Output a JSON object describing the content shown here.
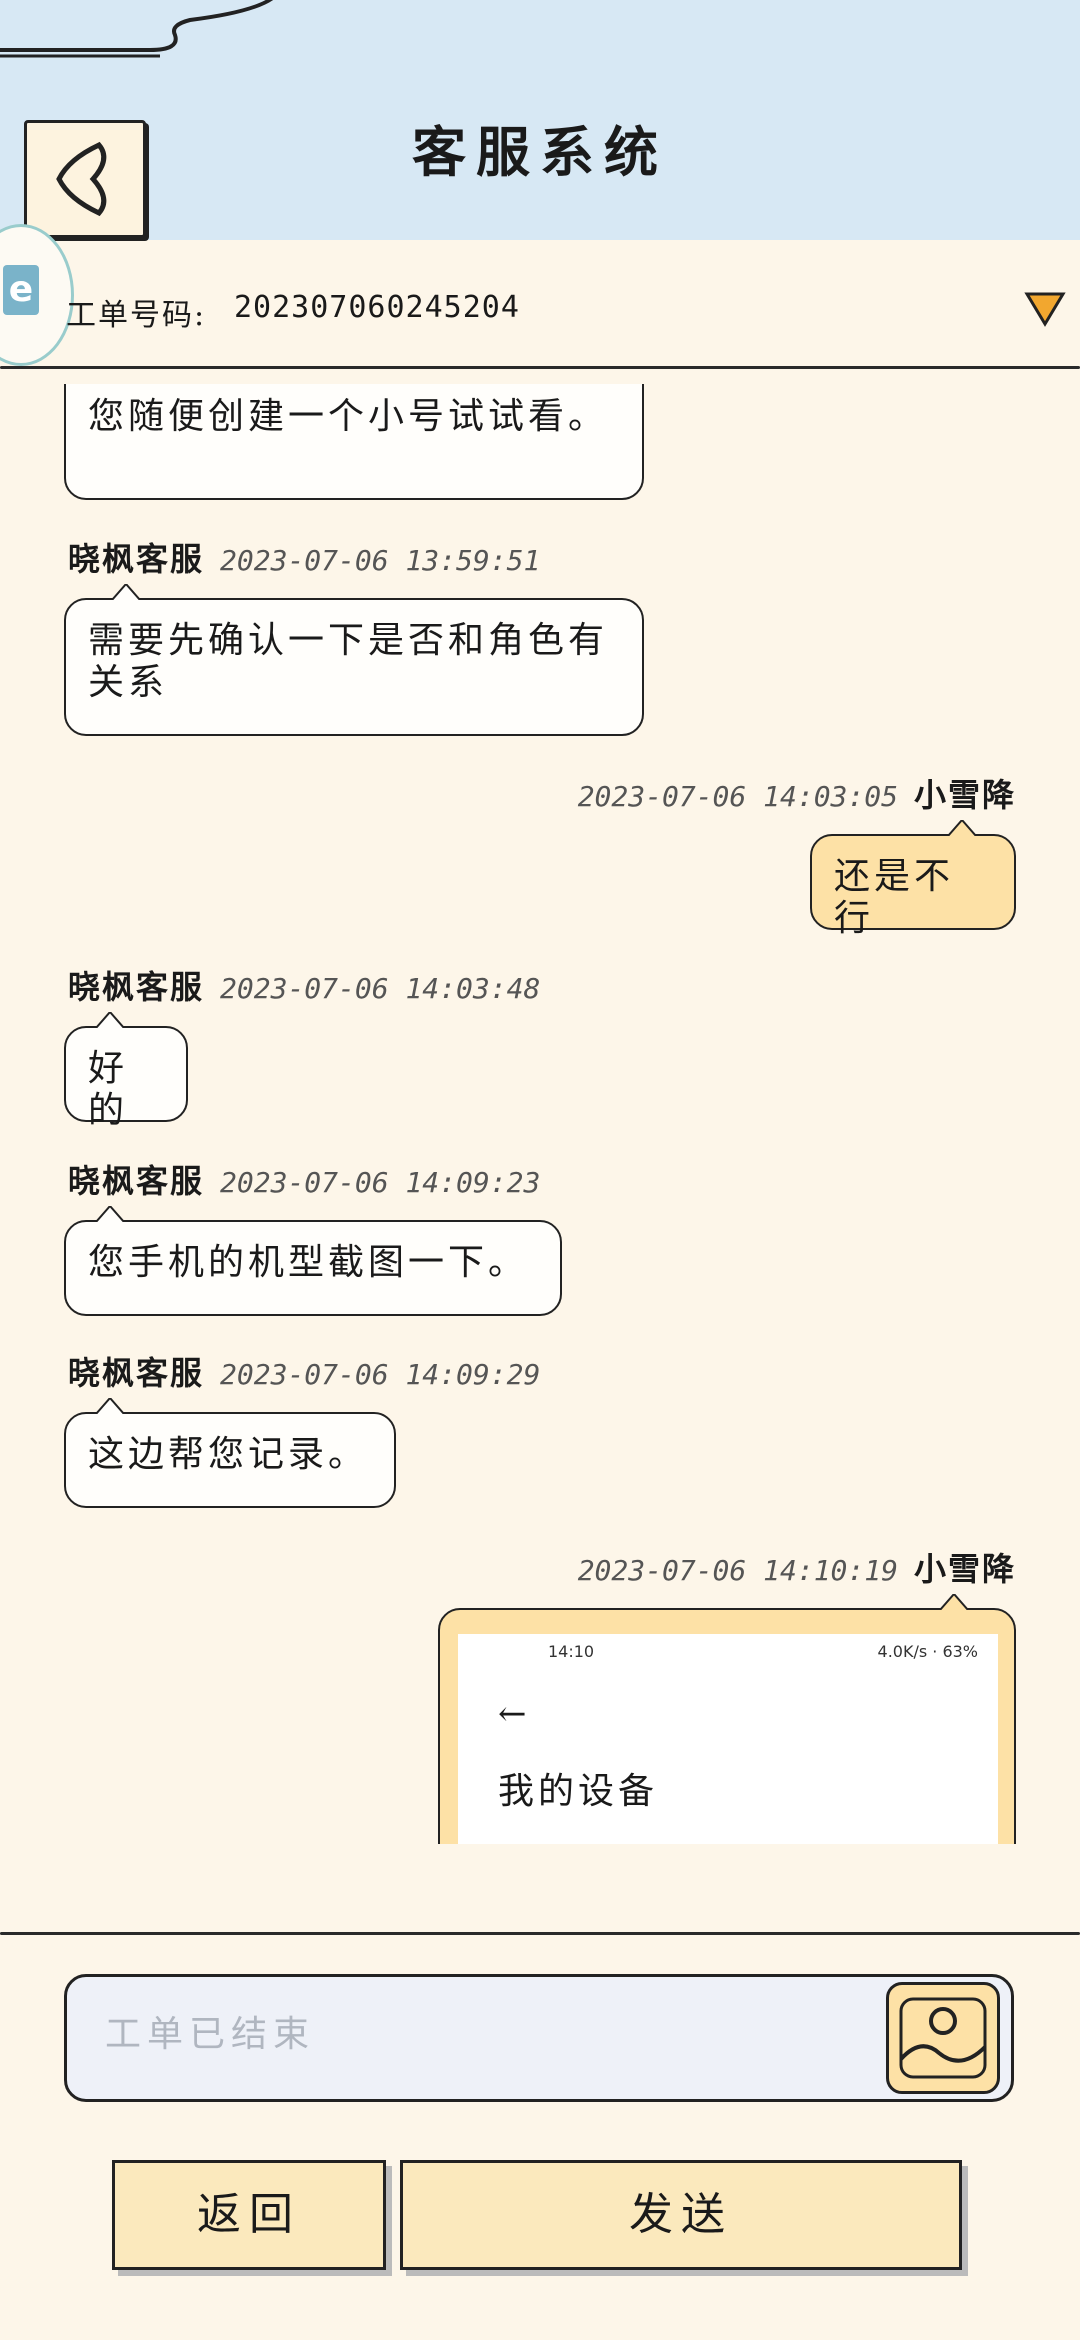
{
  "header": {
    "title": "客服系统"
  },
  "ticket": {
    "label": "工单号码:",
    "number": "20230706024520​4"
  },
  "messages": [
    {
      "text": "您随便创建一个小号试试看。"
    },
    {
      "name": "晓枫客服",
      "time": "2023-07-06 13:59:51",
      "text": "需要先确认一下是否和角色有关系"
    },
    {
      "name": "小雪降",
      "time": "2023-07-06 14:03:05",
      "text": "还是不行"
    },
    {
      "name": "晓枫客服",
      "time": "2023-07-06 14:03:48",
      "text": "好的"
    },
    {
      "name": "晓枫客服",
      "time": "2023-07-06 14:09:23",
      "text": "您手机的机型截图一下。"
    },
    {
      "name": "晓枫客服",
      "time": "2023-07-06 14:09:29",
      "text": "这边帮您记录。"
    },
    {
      "name": "小雪降",
      "time": "2023-07-06 14:10:19"
    }
  ],
  "screenshot": {
    "status_time": "14:10",
    "status_right": "4.0K/s · 63%",
    "back_glyph": "←",
    "heading": "我的设备"
  },
  "input": {
    "placeholder": "工单已结束"
  },
  "buttons": {
    "back": "返回",
    "send": "发送"
  },
  "colors": {
    "header_bg": "#d7e8f4",
    "page_bg": "#fdf6e9",
    "my_bubble": "#fde1a6",
    "button_bg": "#fbe9bd"
  }
}
